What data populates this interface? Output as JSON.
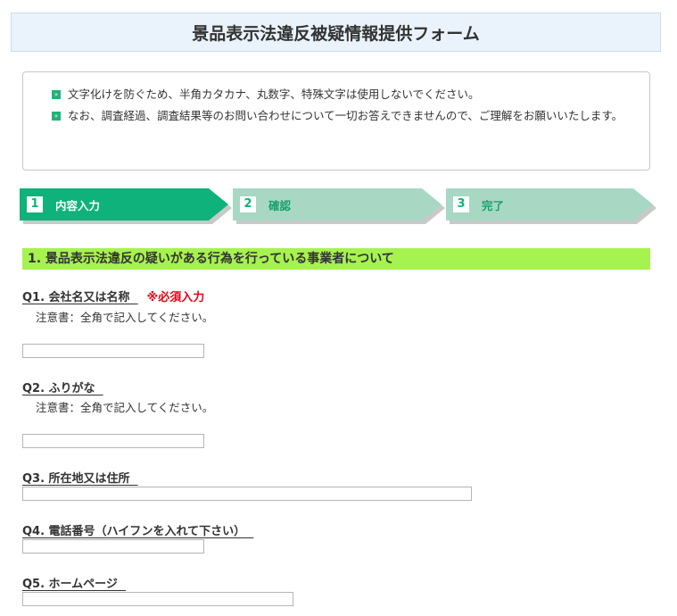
{
  "page": {
    "title": "景品表示法違反被疑情報提供フォーム"
  },
  "notices": [
    "文字化けを防ぐため、半角カタカナ、丸数字、特殊文字は使用しないでください。",
    "なお、調査経過、調査結果等のお問い合わせについて一切お答えできませんので、ご理解をお願いいたします。"
  ],
  "steps": [
    {
      "num": "1",
      "label": "内容入力"
    },
    {
      "num": "2",
      "label": "確認"
    },
    {
      "num": "3",
      "label": "完了"
    }
  ],
  "section": {
    "heading": "1. 景品表示法違反の疑いがある行為を行っている事業者について"
  },
  "questions": {
    "q1": {
      "label": "Q1. 会社名又は名称  ",
      "required": "※必須入力",
      "note": "注意書：全角で記入してください。",
      "value": ""
    },
    "q2": {
      "label": "Q2. ふりがな  ",
      "note": "注意書：全角で記入してください。",
      "value": ""
    },
    "q3": {
      "label": "Q3. 所在地又は住所  ",
      "value": ""
    },
    "q4": {
      "label": "Q4. 電話番号（ハイフンを入れて下さい）  ",
      "value": ""
    },
    "q5": {
      "label": "Q5. ホームページ  ",
      "value": ""
    }
  },
  "colors": {
    "accent_green": "#0fb27a",
    "step_inactive": "#a8d8c3",
    "section_heading_bg": "#a6f24f",
    "required_red": "#e60012",
    "title_bg": "#eaf2fb"
  }
}
